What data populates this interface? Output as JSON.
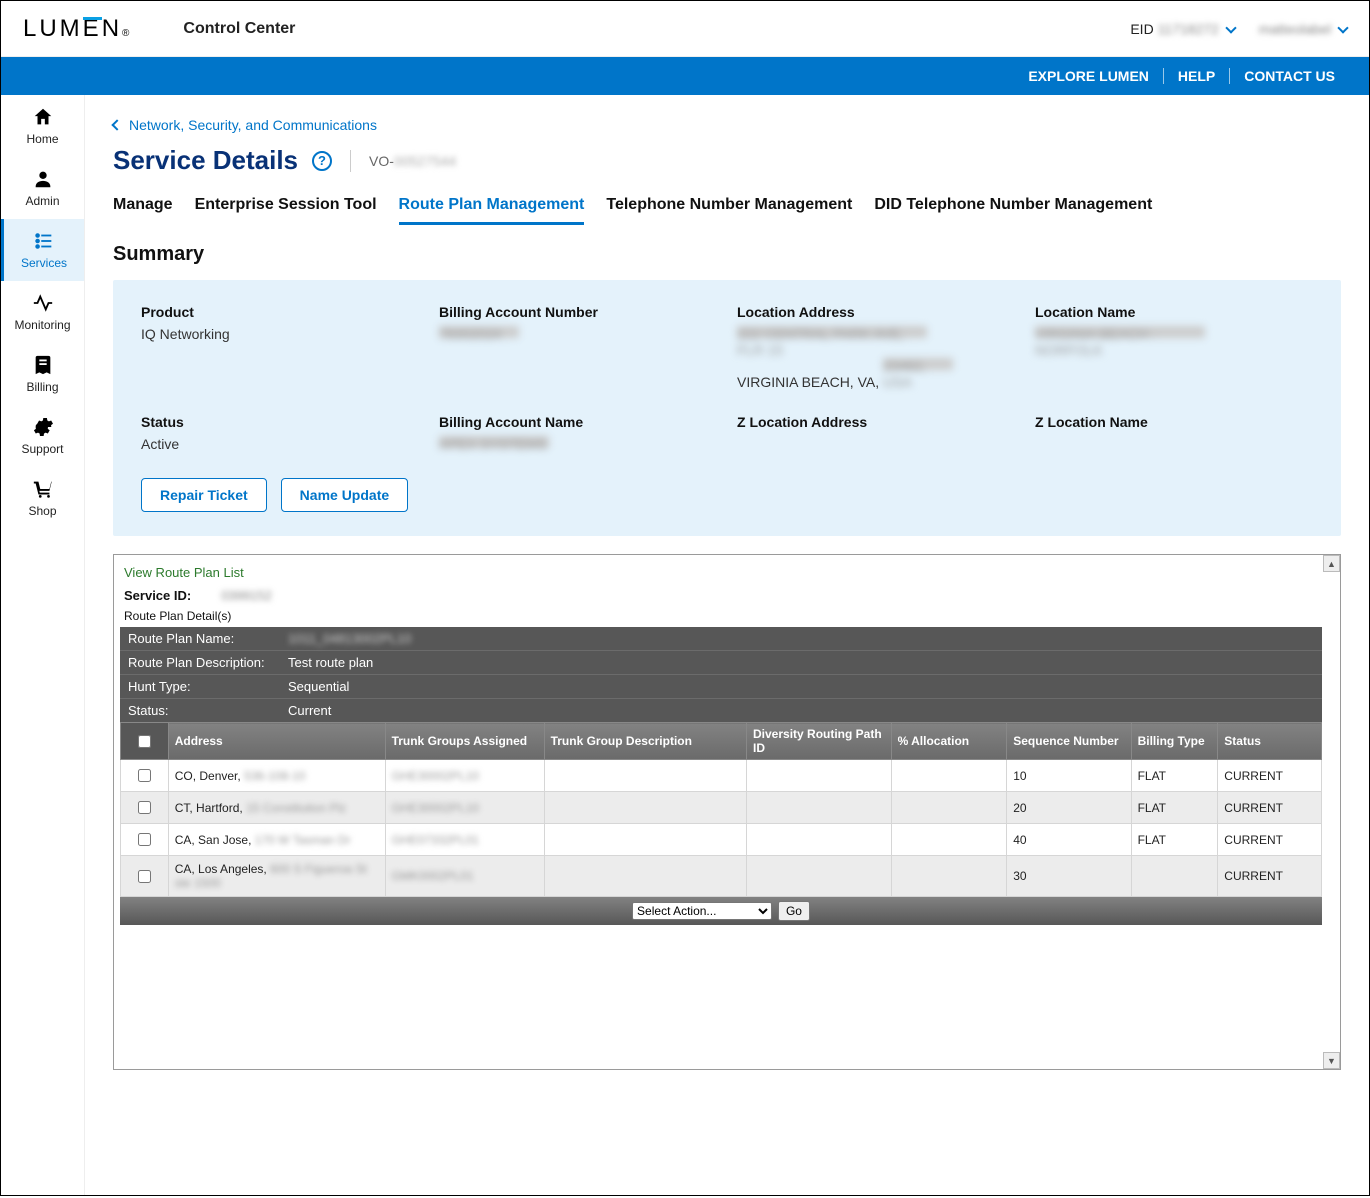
{
  "header": {
    "logo_text_1": "LUM",
    "logo_text_2": "E",
    "logo_text_3": "N",
    "logo_reg": "®",
    "app_name": "Control Center",
    "eid_label": "EID",
    "eid_value": "11718272",
    "username": "matteolabel"
  },
  "top_nav": {
    "explore": "EXPLORE LUMEN",
    "help": "HELP",
    "contact": "CONTACT US"
  },
  "sidebar": {
    "items": [
      {
        "key": "home",
        "label": "Home"
      },
      {
        "key": "admin",
        "label": "Admin"
      },
      {
        "key": "services",
        "label": "Services"
      },
      {
        "key": "monitoring",
        "label": "Monitoring"
      },
      {
        "key": "billing",
        "label": "Billing"
      },
      {
        "key": "support",
        "label": "Support"
      },
      {
        "key": "shop",
        "label": "Shop"
      }
    ]
  },
  "breadcrumb": {
    "text": "Network, Security, and Communications"
  },
  "page": {
    "title": "Service Details",
    "vo_prefix": "VO-",
    "vo_value": "00527544"
  },
  "tabs": [
    {
      "label": "Manage",
      "active": false
    },
    {
      "label": "Enterprise Session Tool",
      "active": false
    },
    {
      "label": "Route Plan Management",
      "active": true
    },
    {
      "label": "Telephone Number Management",
      "active": false
    },
    {
      "label": "DID Telephone Number Management",
      "active": false
    }
  ],
  "section_title": "Summary",
  "summary": {
    "product": {
      "label": "Product",
      "value": "IQ Networking"
    },
    "billing_account_number": {
      "label": "Billing Account Number",
      "value": "78302024"
    },
    "location_address": {
      "label": "Location Address",
      "value1": "222 CENTRAL PARK AVE, FLR 15",
      "value2": "VIRGINIA BEACH, VA,",
      "value2_blur": "23462, USA"
    },
    "location_name": {
      "label": "Location Name",
      "value": "VIRGINIA BEACH - NORFOLK"
    },
    "status": {
      "label": "Status",
      "value": "Active"
    },
    "billing_account_name": {
      "label": "Billing Account Name",
      "value": "APEX SYSTEMS"
    },
    "z_location_address": {
      "label": "Z Location Address",
      "value": ""
    },
    "z_location_name": {
      "label": "Z Location Name",
      "value": ""
    }
  },
  "buttons": {
    "repair_ticket": "Repair Ticket",
    "name_update": "Name Update"
  },
  "route_plan": {
    "view_list": "View Route Plan List",
    "service_id_label": "Service ID:",
    "service_id_value": "0399152",
    "detail_header": "Route Plan Detail(s)",
    "name_label": "Route Plan Name:",
    "name_value": "1011_04813002PL10",
    "desc_label": "Route Plan Description:",
    "desc_value": "Test route plan",
    "hunt_label": "Hunt Type:",
    "hunt_value": "Sequential",
    "status_label": "Status:",
    "status_value": "Current",
    "columns": {
      "address": "Address",
      "trunk_groups": "Trunk Groups Assigned",
      "trunk_desc": "Trunk Group Description",
      "diversity": "Diversity Routing Path ID",
      "allocation": "% Allocation",
      "sequence": "Sequence Number",
      "billing_type": "Billing Type",
      "status": "Status"
    },
    "rows": [
      {
        "addr_1": "CO, Denver,",
        "addr_2": "536-108-10",
        "trunk": "GHE30002PL10",
        "seq": "10",
        "billing": "FLAT",
        "status": "CURRENT"
      },
      {
        "addr_1": "CT, Hartford,",
        "addr_2": "15 Constitution Plz",
        "trunk": "GHE30002PL10",
        "seq": "20",
        "billing": "FLAT",
        "status": "CURRENT"
      },
      {
        "addr_1": "CA, San Jose,",
        "addr_2": "170 W Tasman Dr",
        "trunk": "GHE07332PL01",
        "seq": "40",
        "billing": "FLAT",
        "status": "CURRENT"
      },
      {
        "addr_1": "CA, Los Angeles,",
        "addr_2": "600 S Figueroa St ste 1500",
        "trunk": "GMK0002PL01",
        "seq": "30",
        "billing": "",
        "status": "CURRENT"
      }
    ],
    "action_placeholder": "Select Action...",
    "go": "Go"
  }
}
